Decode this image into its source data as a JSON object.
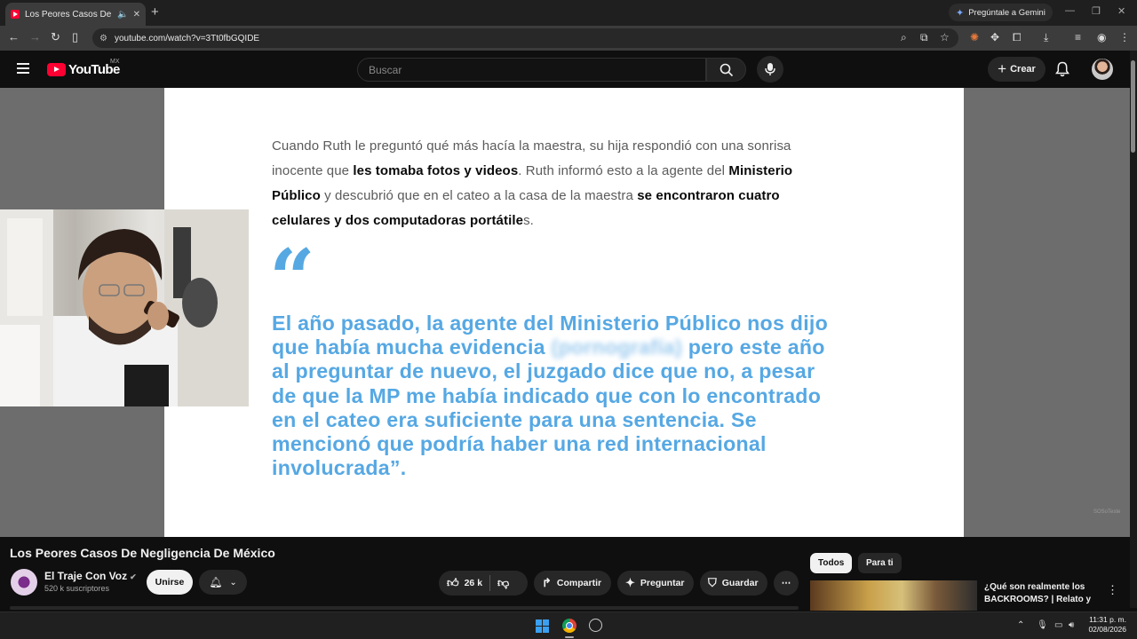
{
  "browser": {
    "tab_title": "Los Peores Casos De Negligencia De México - YouTube",
    "gemini_label": "Pregúntale a Gemini",
    "url": "youtube.com/watch?v=3Tt0fbGQIDE"
  },
  "youtube": {
    "logo_text": "YouTube",
    "country_code": "MX",
    "search_placeholder": "Buscar",
    "create_label": "Crear"
  },
  "slide": {
    "paragraph": [
      {
        "text": "Cuando Ruth le preguntó qué más hacía la maestra, su hija respondió con una sonrisa inocente que ",
        "bold": false
      },
      {
        "text": "les tomaba fotos y videos",
        "bold": true
      },
      {
        "text": ". Ruth informó esto a la agente del ",
        "bold": false
      },
      {
        "text": "Ministerio Público",
        "bold": true
      },
      {
        "text": " y descubrió que en el cateo a la casa de la maestra ",
        "bold": false
      },
      {
        "text": "se encontraron cuatro celulares y dos computadoras portátile",
        "bold": true
      },
      {
        "text": "s.",
        "bold": false
      }
    ],
    "quote_mark": "“",
    "quote_before": "El año pasado, la agente del Ministerio Público nos dijo que había mucha evidencia ",
    "quote_blurred": "(pornografía)",
    "quote_after": " pero este año al preguntar de nuevo, el juzgado dice que no, a pesar de que la MP me había indicado que con lo encontrado en el cateo era suficiente para una sentencia. Se mencionó que podría haber una red internacional involucrada”.",
    "watermark": "SOSoTeste"
  },
  "video": {
    "title": "Los Peores Casos De Negligencia De México",
    "channel_name": "El Traje Con Voz",
    "subscribers": "520 k suscriptores",
    "join_label": "Unirse",
    "likes": "26 k",
    "share_label": "Compartir",
    "ask_label": "Preguntar",
    "save_label": "Guardar"
  },
  "sidebar": {
    "chips": [
      "Todos",
      "Para ti"
    ],
    "recommendation_title": "¿Qué son realmente los BACKROOMS? | Relato y ..."
  },
  "taskbar": {
    "time": "11:31 p. m.",
    "date": "02/08/2026"
  },
  "icons": [
    "hamburger-icon",
    "search-icon",
    "mic-icon",
    "bell-icon",
    "like-icon",
    "dislike-icon",
    "share-icon",
    "spark-icon",
    "bookmark-icon",
    "more-icon",
    "verified-icon"
  ]
}
